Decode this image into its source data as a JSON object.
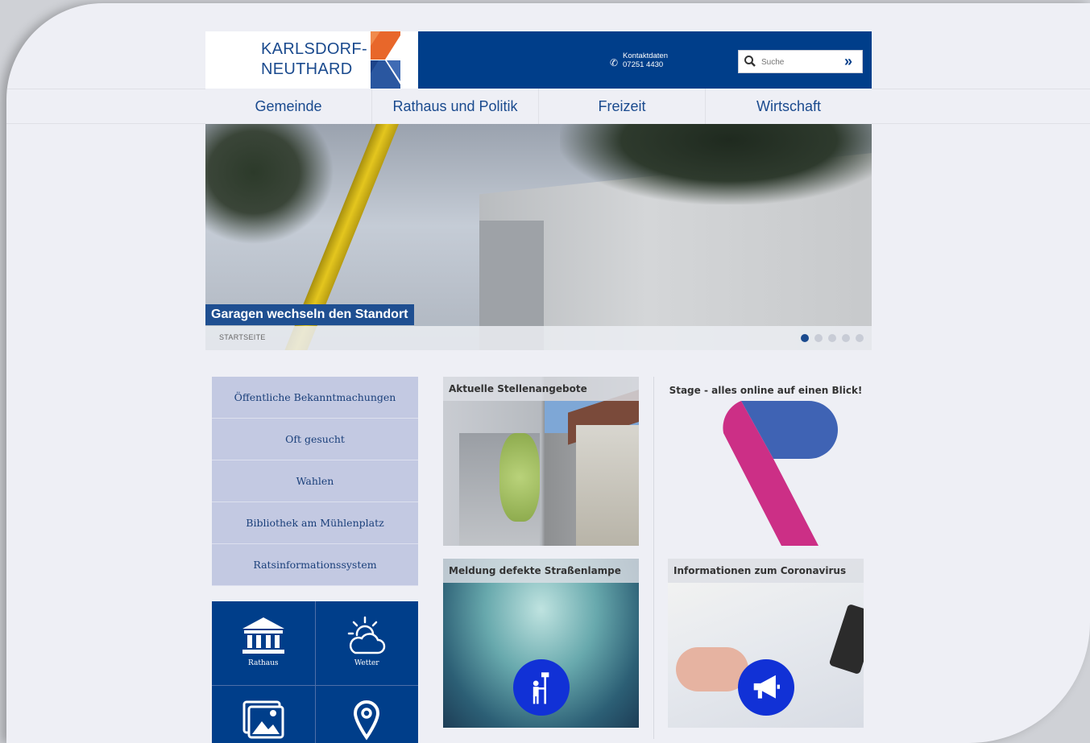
{
  "header": {
    "logo_line1": "KARLSDORF-",
    "logo_line2": "NEUTHARD",
    "contact_label": "Kontaktdaten",
    "contact_phone": "07251 4430",
    "search_placeholder": "Suche",
    "search_go": "»",
    "brand_color": "#003e8a"
  },
  "nav": {
    "items": [
      "Gemeinde",
      "Rathaus und Politik",
      "Freizeit",
      "Wirtschaft"
    ]
  },
  "hero": {
    "caption": "Garagen wechseln den Standort",
    "breadcrumb": "STARTSEITE",
    "slide_count": 5,
    "active_slide": 1
  },
  "left_menu": {
    "items": [
      "Öffentliche Bekanntmachungen",
      "Oft gesucht",
      "Wahlen",
      "Bibliothek am Mühlenplatz",
      "Ratsinformationssystem"
    ]
  },
  "tiles": [
    {
      "label": "Rathaus",
      "icon": "town-hall-icon"
    },
    {
      "label": "Wetter",
      "icon": "weather-icon"
    },
    {
      "label": "",
      "icon": "gallery-icon"
    },
    {
      "label": "",
      "icon": "location-pin-icon"
    }
  ],
  "cards": {
    "jobs_title": "Aktuelle Stellenangebote",
    "stage_title": "Stage - alles online auf einen Blick!",
    "lamp_title": "Meldung defekte Straßenlampe",
    "corona_title": "Informationen zum Coronavirus"
  }
}
